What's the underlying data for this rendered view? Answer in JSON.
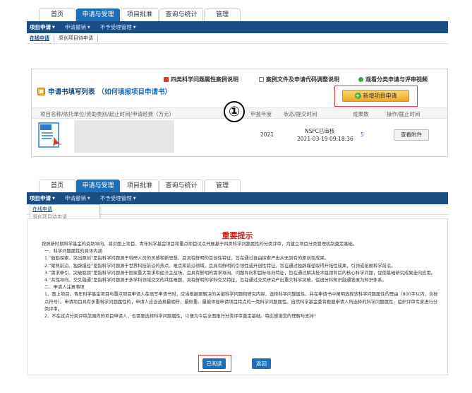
{
  "nav": {
    "tabs": [
      "首页",
      "申请与受理",
      "项目批准",
      "查询与统计",
      "管理"
    ],
    "active_tab": 1,
    "sub_items": [
      "项目申请",
      "申请撤销",
      "不予受理管理"
    ],
    "breadcrumbs": [
      "在线申请",
      "原创项目待申请"
    ]
  },
  "list": {
    "links": [
      "四类科学问题属性案例说明",
      "案例文件及申请代码调整说明",
      "观看分类申请与评审视频"
    ],
    "title": "申请书填写列表",
    "hint": "（如何填报项目申请书）",
    "new_button": "新增项目申请",
    "headers": [
      "项目名称/依托单位/资助类别/起止时间/申请经费（万元）",
      "申报年度",
      "状态/提交时间",
      "成果数",
      "操作/截止时间"
    ],
    "row": {
      "year": "2021",
      "status": "NSFC已审核",
      "time": "2021-03-19 09:18:36",
      "count": "5",
      "action": "查看附件"
    },
    "callout": "①"
  },
  "nav2_dropdown": [
    "在线申请",
    "原创项目待申请"
  ],
  "dialog": {
    "title": "重要提示",
    "lines": [
      "按照新时期科学基金的资助导向，将对面上项目、青年科学基金项目和重点项目试点开展基于四类科学问题属性的分类评审，为建立项目分类管理机制奠定基础。",
      "一、科学问题属性的具体内涵",
      "1.“鼓励探索、突出原创”是指科学问题源于科研人员的灵感和新思想，且具有鲜明的首创性特征，旨在通过自由探索产出从无到有的原创性成果。",
      "2.“聚焦前沿、独辟蹊径”是指科学问题源于世界科技前沿的热点、难点和前沿领域，且具有鲜明的引领性或开创性特征，旨在通过独辟蹊径取得开拓性成果，引领或拓展科学前沿。",
      "3.“需求牵引、突破瓶颈”是指科学问题源于国家重大需求和经济主战场，且具有鲜明的需求导向、问题导向和目标导向特征，旨在通过解决技术瓶颈背后的核心科学问题，促使基础研究成果走向应用。",
      "4.“共性导向、交叉融通”是指科学问题源于多学科领域交叉的共性难题，具有鲜明的学科交叉特征，旨在通过交叉研究产出重大科学突破，促进分科知识融通发展为知识体系。",
      "二、申请人注意事项",
      "1、面上项目、青年科学基金项目与重点项目申请人在填写申请书时，应当根据要解决的关键科学问题和研究内容，选择科学问题属性，并在申请书中阐明选择该科学问题属性的理由（800字以内，含标点符号）。申请项目具有多重科学问题属性的，申请人应当选择最相符、最侧重、最能体现申请项目特点的一类科学问题属性。自然科学基金委将根据申请人所选择的科学问题属性，组织评审专家进行分类评审。",
      "2、不在试点分类评审范围内的项目申请人，也需要选择科学问题属性，以便为今后全面推行分类评审奠定基础。特此感谢您的理解与支持！"
    ],
    "read_button": "已阅读",
    "back_button": "返回"
  }
}
